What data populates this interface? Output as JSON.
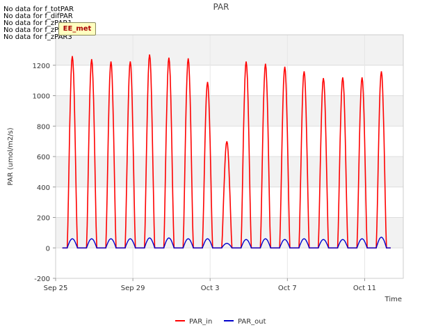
{
  "chart_data": {
    "type": "line",
    "title": "PAR",
    "xlabel": "Time",
    "ylabel": "PAR (umol/m2/s)",
    "ylim": [
      -200,
      1400
    ],
    "yticks": [
      -200,
      0,
      200,
      400,
      600,
      800,
      1000,
      1200
    ],
    "xlim_days": [
      0,
      18
    ],
    "xticks": [
      {
        "label": "Sep 25",
        "day": 0
      },
      {
        "label": "Sep 29",
        "day": 4
      },
      {
        "label": "Oct 3",
        "day": 8
      },
      {
        "label": "Oct 7",
        "day": 12
      },
      {
        "label": "Oct 11",
        "day": 16
      }
    ],
    "grid": true,
    "legend_position": "bottom-center",
    "colors": {
      "PAR_in": "#ff0000",
      "PAR_out": "#0000cc"
    },
    "series": [
      {
        "name": "PAR_in",
        "daily_peaks": [
          {
            "day": "Sep 25",
            "peak": 1260
          },
          {
            "day": "Sep 26",
            "peak": 1240
          },
          {
            "day": "Sep 27",
            "peak": 1225
          },
          {
            "day": "Sep 28",
            "peak": 1225
          },
          {
            "day": "Sep 29",
            "peak": 1270
          },
          {
            "day": "Sep 30",
            "peak": 1250
          },
          {
            "day": "Oct 1",
            "peak": 1245
          },
          {
            "day": "Oct 2",
            "peak": 1090
          },
          {
            "day": "Oct 3",
            "peak": 700
          },
          {
            "day": "Oct 4",
            "peak": 1225
          },
          {
            "day": "Oct 5",
            "peak": 1210
          },
          {
            "day": "Oct 6",
            "peak": 1190
          },
          {
            "day": "Oct 7",
            "peak": 1160
          },
          {
            "day": "Oct 8",
            "peak": 1115
          },
          {
            "day": "Oct 9",
            "peak": 1120
          },
          {
            "day": "Oct 10",
            "peak": 1120
          },
          {
            "day": "Oct 11",
            "peak": 1160
          }
        ]
      },
      {
        "name": "PAR_out",
        "daily_peaks": [
          {
            "day": "Sep 25",
            "peak": 60
          },
          {
            "day": "Sep 26",
            "peak": 60
          },
          {
            "day": "Sep 27",
            "peak": 60
          },
          {
            "day": "Sep 28",
            "peak": 60
          },
          {
            "day": "Sep 29",
            "peak": 65
          },
          {
            "day": "Sep 30",
            "peak": 65
          },
          {
            "day": "Oct 1",
            "peak": 60
          },
          {
            "day": "Oct 2",
            "peak": 60
          },
          {
            "day": "Oct 3",
            "peak": 30
          },
          {
            "day": "Oct 4",
            "peak": 55
          },
          {
            "day": "Oct 5",
            "peak": 60
          },
          {
            "day": "Oct 6",
            "peak": 55
          },
          {
            "day": "Oct 7",
            "peak": 60
          },
          {
            "day": "Oct 8",
            "peak": 55
          },
          {
            "day": "Oct 9",
            "peak": 55
          },
          {
            "day": "Oct 10",
            "peak": 60
          },
          {
            "day": "Oct 11",
            "peak": 70
          }
        ]
      }
    ]
  },
  "notes": [
    "No data for f_totPAR",
    "No data for f_difPAR",
    "No data for f_zPAR1",
    "No data for f_zPAR2",
    "No data for f_zPAR3"
  ],
  "badge": "EE_met"
}
